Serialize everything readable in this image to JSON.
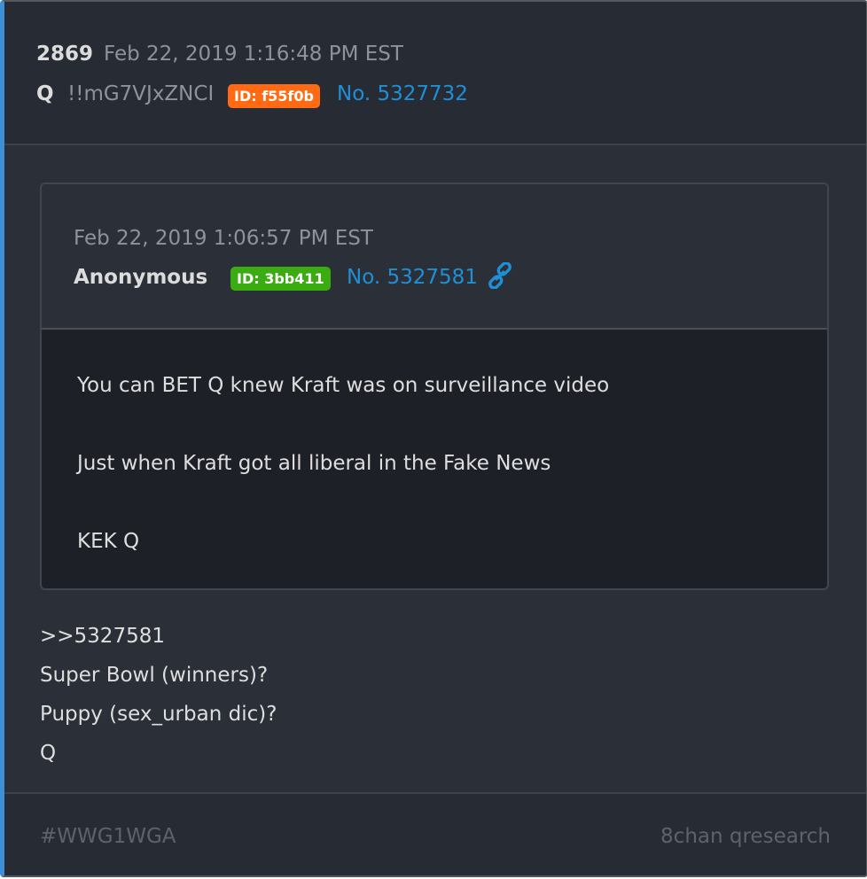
{
  "post": {
    "number": "2869",
    "date": "Feb 22, 2019 1:16:48 PM EST",
    "author": "Q",
    "tripcode": "!!mG7VJxZNCI",
    "id_label": "ID: f55f0b",
    "link_label": "No. 5327732"
  },
  "quoted": {
    "date": "Feb 22, 2019 1:06:57 PM EST",
    "author": "Anonymous",
    "id_label": "ID: 3bb411",
    "link_label": "No. 5327581",
    "link_icon": "link-icon",
    "lines": [
      "You can BET Q knew Kraft was on surveillance video",
      "Just when Kraft got all liberal in the Fake News",
      "KEK Q"
    ]
  },
  "reply": {
    "lines": [
      ">>5327581",
      "Super Bowl (winners)?",
      "Puppy (sex_urban dic)?",
      "Q"
    ]
  },
  "footer": {
    "tag": "#WWG1WGA",
    "source": "8chan qresearch"
  },
  "colors": {
    "accent_border": "#3e8fd6",
    "id_orange": "#ff6a13",
    "id_green": "#3bab12",
    "link": "#1f8fd6",
    "background": "#2b3038"
  }
}
